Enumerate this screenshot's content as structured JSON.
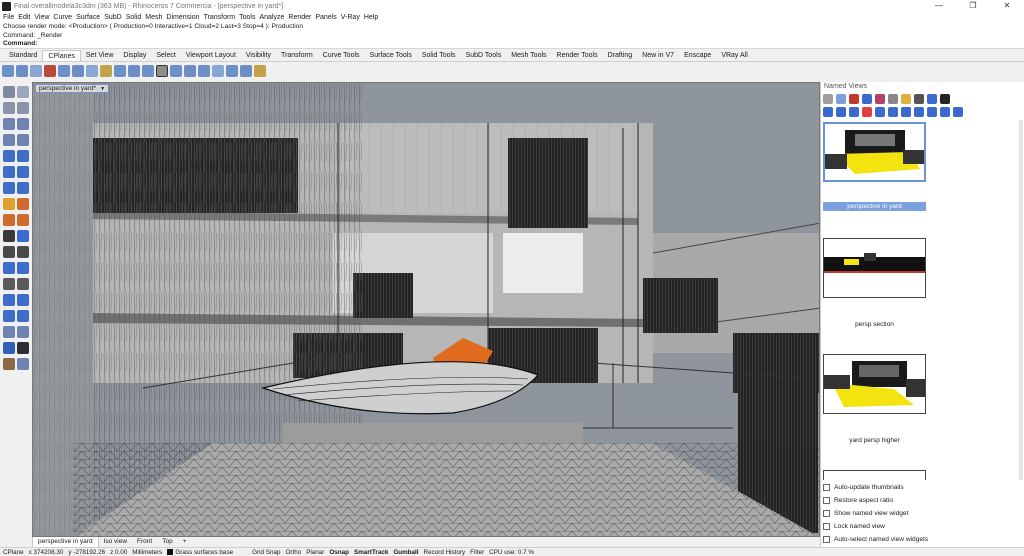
{
  "window": {
    "title": "Final overallmodela3c3dm (363 MB) - Rhinoceros 7 Commercia - [perspective in yard*]",
    "minimize": "—",
    "maximize": "❐",
    "close": "✕"
  },
  "menu": [
    "File",
    "Edit",
    "View",
    "Curve",
    "Surface",
    "SubD",
    "Solid",
    "Mesh",
    "Dimension",
    "Transform",
    "Tools",
    "Analyze",
    "Render",
    "Panels",
    "V-Ray",
    "Help"
  ],
  "command": {
    "history1": "Choose render mode: <Production> ( Production=0  Interactive=1  Cloud=2  Last=3  Stop=4 ): Production",
    "history2": "Command: _Render",
    "prompt": "Command:"
  },
  "tabs": [
    "Standard",
    "CPlanes",
    "Set View",
    "Display",
    "Select",
    "Viewport Layout",
    "Visibility",
    "Transform",
    "Curve Tools",
    "Surface Tools",
    "Solid Tools",
    "SubD Tools",
    "Mesh Tools",
    "Render Tools",
    "Drafting",
    "New in V7",
    "Enscape",
    "VRay All"
  ],
  "active_tab": "CPlanes",
  "viewport": {
    "label": "perspective in yard*",
    "dropdown": "▼"
  },
  "viewport_tabs": [
    "perspective in yard",
    "Iso view",
    "Front",
    "Top",
    "+"
  ],
  "status": {
    "cplane": "CPlane",
    "x": "x 374208.30",
    "y": "y -278192.26",
    "z": "z 0.00",
    "units": "Millimeters",
    "layer": "Grass surfaces base",
    "grid_snap": "Grid Snap",
    "ortho": "Ortho",
    "planar": "Planar",
    "osnap": "Osnap",
    "smarttrack": "SmartTrack",
    "gumball": "Gumball",
    "record_history": "Record History",
    "filter": "Filter",
    "cpu": "CPU use: 0.7 %"
  },
  "panel": {
    "title": "Named Views",
    "views": [
      {
        "name": "perspective in yard",
        "selected": true
      },
      {
        "name": "persp section",
        "selected": false
      },
      {
        "name": "yard persp higher",
        "selected": false
      }
    ],
    "options": [
      "Auto-update thumbnails",
      "Restore aspect ratio",
      "Show named view widget",
      "Lock named view",
      "Auto-select named view widgets"
    ]
  }
}
